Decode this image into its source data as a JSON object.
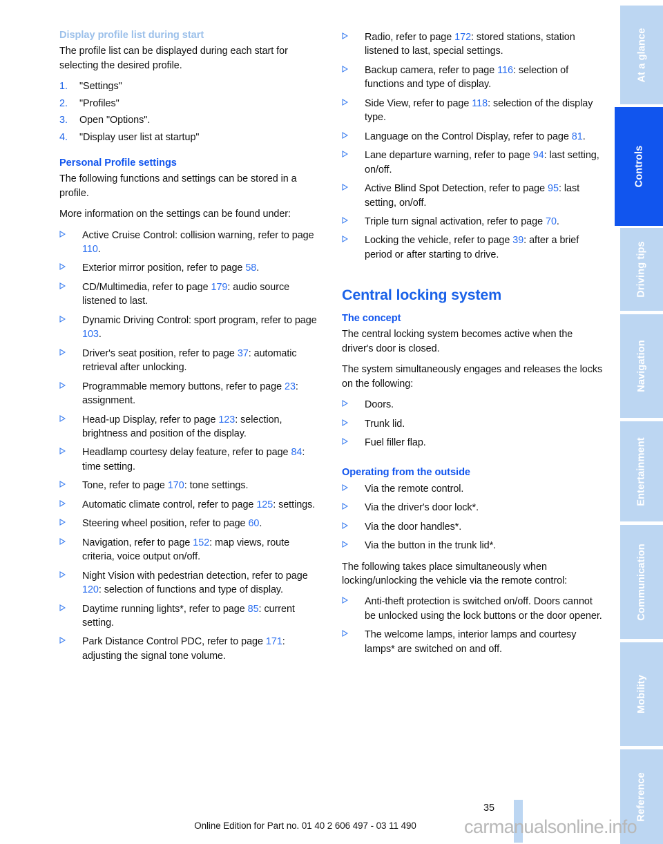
{
  "document": {
    "page_number": "35",
    "footer_text": "Online Edition for Part no. 01 40 2 606 497 - 03 11 490",
    "watermark": "carmanualsonline.info",
    "accent_blue": "#1155ee",
    "link_blue": "#2a6ef0",
    "faded_blue": "#9cc0ea",
    "tab_blue": "#bcd6f2"
  },
  "tab_rail": {
    "items": [
      {
        "label": "At a glance",
        "active": false
      },
      {
        "label": "Controls",
        "active": true
      },
      {
        "label": "Driving tips",
        "active": false
      },
      {
        "label": "Navigation",
        "active": false
      },
      {
        "label": "Entertainment",
        "active": false
      },
      {
        "label": "Communication",
        "active": false
      },
      {
        "label": "Mobility",
        "active": false
      },
      {
        "label": "Reference",
        "active": false
      }
    ]
  },
  "left_column": {
    "heading_display_profile": "Display profile list during start",
    "para_profile_intro": "The profile list can be displayed during each start for selecting the desired profile.",
    "steps": [
      {
        "marker": "1.",
        "text": "\"Settings\""
      },
      {
        "marker": "2.",
        "text": "\"Profiles\""
      },
      {
        "marker": "3.",
        "text": "Open \"Options\"."
      },
      {
        "marker": "4.",
        "text": "\"Display user list at startup\""
      }
    ],
    "heading_personal_profile": "Personal Profile settings",
    "para_stored": "The following functions and settings can be stored in a profile.",
    "para_more_info": "More information on the settings can be found under:",
    "bullets": [
      {
        "pre": "Active Cruise Control: collision warning, refer to page ",
        "page": "110",
        "post": "."
      },
      {
        "pre": "Exterior mirror position, refer to page ",
        "page": "58",
        "post": "."
      },
      {
        "pre": "CD/Multimedia, refer to page ",
        "page": "179",
        "post": ": audio source listened to last."
      },
      {
        "pre": "Dynamic Driving Control: sport program, refer to page ",
        "page": "103",
        "post": "."
      },
      {
        "pre": "Driver's seat position, refer to page ",
        "page": "37",
        "post": ": automatic retrieval after unlocking."
      },
      {
        "pre": "Programmable memory buttons, refer to page ",
        "page": "23",
        "post": ": assignment."
      },
      {
        "pre": "Head-up Display, refer to page ",
        "page": "123",
        "post": ": selection, brightness and position of the display."
      },
      {
        "pre": "Headlamp courtesy delay feature, refer to page ",
        "page": "84",
        "post": ": time setting."
      },
      {
        "pre": "Tone, refer to page ",
        "page": "170",
        "post": ": tone settings."
      },
      {
        "pre": "Automatic climate control, refer to page ",
        "page": "125",
        "post": ": settings."
      },
      {
        "pre": "Steering wheel position, refer to page ",
        "page": "60",
        "post": "."
      },
      {
        "pre": "Navigation, refer to page ",
        "page": "152",
        "post": ": map views, route criteria, voice output on/off."
      },
      {
        "pre": "Night Vision with pedestrian detection, refer to page ",
        "page": "120",
        "post": ": selection of functions and type of display."
      },
      {
        "pre": "Daytime running lights*, refer to page ",
        "page": "85",
        "post": ": current setting."
      },
      {
        "pre": "Park Distance Control PDC, refer to page ",
        "page": "171",
        "post": ": adjusting the signal tone volume."
      }
    ]
  },
  "right_column": {
    "bullets_top": [
      {
        "pre": "Radio, refer to page ",
        "page": "172",
        "post": ": stored stations, station listened to last, special settings."
      },
      {
        "pre": "Backup camera, refer to page ",
        "page": "116",
        "post": ": selection of functions and type of display."
      },
      {
        "pre": "Side View, refer to page ",
        "page": "118",
        "post": ": selection of the display type."
      },
      {
        "pre": "Language on the Control Display, refer to page ",
        "page": "81",
        "post": "."
      },
      {
        "pre": "Lane departure warning, refer to page ",
        "page": "94",
        "post": ": last setting, on/off."
      },
      {
        "pre": "Active Blind Spot Detection, refer to page ",
        "page": "95",
        "post": ": last setting, on/off."
      },
      {
        "pre": "Triple turn signal activation, refer to page ",
        "page": "70",
        "post": "."
      },
      {
        "pre": "Locking the vehicle, refer to page ",
        "page": "39",
        "post": ": after a brief period or after starting to drive."
      }
    ],
    "heading_central_locking": "Central locking system",
    "heading_concept": "The concept",
    "para_concept_1": "The central locking system becomes active when the driver's door is closed.",
    "para_concept_2": "The system simultaneously engages and releases the locks on the following:",
    "bullets_locks": [
      {
        "pre": "Doors.",
        "page": "",
        "post": ""
      },
      {
        "pre": "Trunk lid.",
        "page": "",
        "post": ""
      },
      {
        "pre": "Fuel filler flap.",
        "page": "",
        "post": ""
      }
    ],
    "heading_operating_outside": "Operating from the outside",
    "bullets_operating": [
      {
        "pre": "Via the remote control.",
        "page": "",
        "post": ""
      },
      {
        "pre": "Via the driver's door lock*.",
        "page": "",
        "post": ""
      },
      {
        "pre": "Via the door handles*.",
        "page": "",
        "post": ""
      },
      {
        "pre": "Via the button in the trunk lid*.",
        "page": "",
        "post": ""
      }
    ],
    "para_simultaneous": "The following takes place simultaneously when locking/unlocking the vehicle via the remote control:",
    "bullets_simultaneous": [
      {
        "pre": "Anti-theft protection is switched on/off. Doors cannot be unlocked using the lock buttons or the door opener.",
        "page": "",
        "post": ""
      },
      {
        "pre": "The welcome lamps, interior lamps and courtesy lamps* are switched on and off.",
        "page": "",
        "post": ""
      }
    ]
  }
}
